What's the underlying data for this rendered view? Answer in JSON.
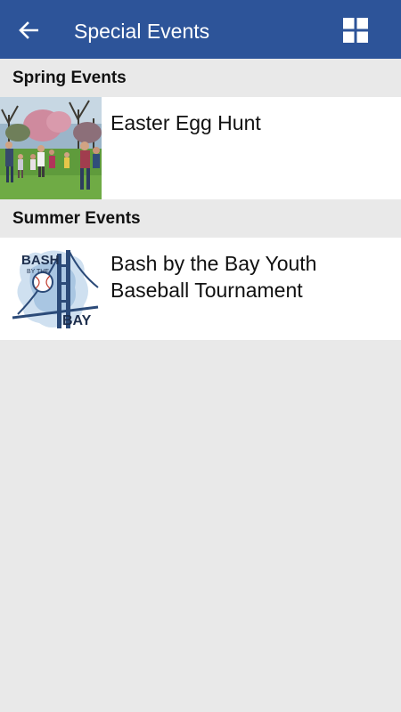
{
  "appbar": {
    "title": "Special Events",
    "back_icon": "arrow-left-icon",
    "grid_icon": "grid-view-icon",
    "background": "#2d5499"
  },
  "sections": [
    {
      "header": "Spring Events",
      "items": [
        {
          "title": "Easter Egg Hunt",
          "thumbnail": "easter-egg-hunt-photo"
        }
      ]
    },
    {
      "header": "Summer Events",
      "items": [
        {
          "title": "Bash by the Bay Youth Baseball Tournament",
          "thumbnail": "bash-by-the-bay-logo",
          "logo_text": {
            "line1": "BASH",
            "line2": "BY THE",
            "line3": "BAY"
          }
        }
      ]
    }
  ]
}
